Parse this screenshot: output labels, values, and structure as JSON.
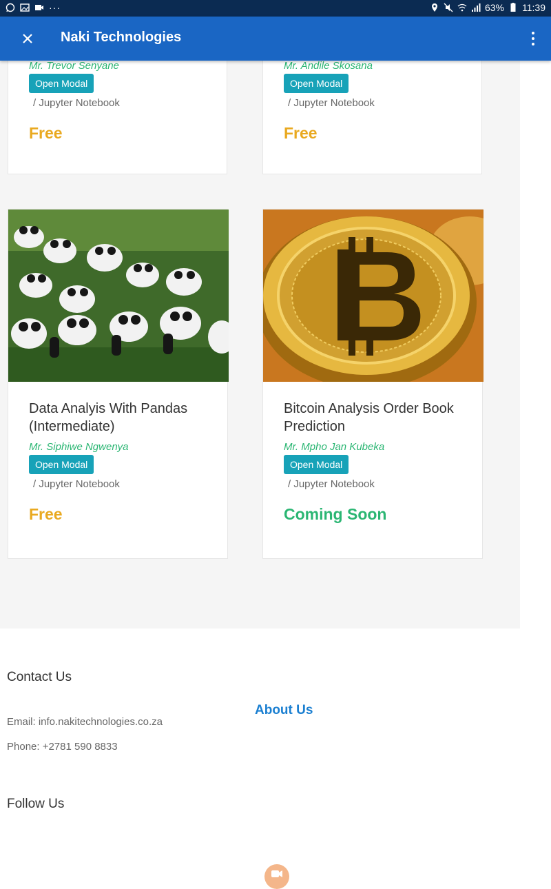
{
  "status_bar": {
    "battery": "63%",
    "time": "11:39"
  },
  "appbar": {
    "title": "Naki Technologies"
  },
  "cards": [
    {
      "author": "Mr. Trevor Senyane",
      "button": "Open Modal",
      "type": "/ Jupyter Notebook",
      "price": "Free"
    },
    {
      "author": "Mr. Andile Skosana",
      "button": "Open Modal",
      "type": "/ Jupyter Notebook",
      "price": "Free"
    },
    {
      "title_line1": "Data Analyis With Pandas",
      "title_line2": "(Intermediate)",
      "author": "Mr. Siphiwe Ngwenya",
      "button": "Open Modal",
      "type": "/ Jupyter Notebook",
      "price": "Free"
    },
    {
      "title_line1": "Bitcoin Analysis Order Book",
      "title_line2": "Prediction",
      "author": "Mr. Mpho Jan Kubeka",
      "button": "Open Modal",
      "type": "/ Jupyter Notebook",
      "price": "Coming Soon"
    }
  ],
  "footer": {
    "contact_heading": "Contact Us",
    "email": "Email: info.nakitechnologies.co.za",
    "phone": "Phone: +2781 590 8833",
    "about_link": "About Us",
    "follow_heading": "Follow Us"
  },
  "colors": {
    "appbar": "#1a66c4",
    "price_free": "#e9a920",
    "price_coming_soon": "#2bb673",
    "author": "#2bb673",
    "button": "#17a2b8",
    "link": "#1a7fd1"
  }
}
